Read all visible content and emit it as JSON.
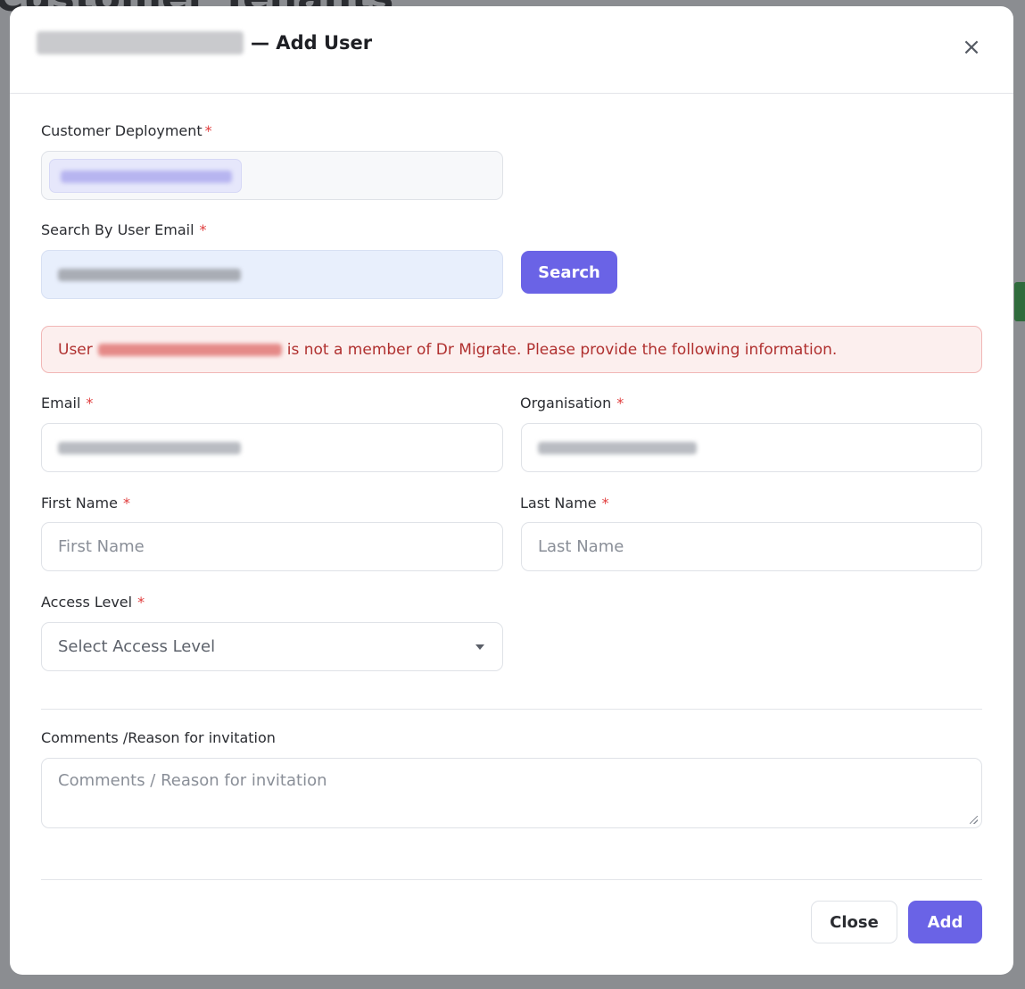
{
  "background": {
    "page_title": "Customer Tenants"
  },
  "modal": {
    "title_suffix": "— Add User",
    "close_icon": "×",
    "customer_deployment": {
      "label": "Customer Deployment"
    },
    "search_email": {
      "label": "Search By User Email",
      "button": "Search"
    },
    "alert": {
      "prefix": "User",
      "suffix": "is not a member of Dr Migrate. Please provide the following information."
    },
    "email": {
      "label": "Email"
    },
    "organisation": {
      "label": "Organisation"
    },
    "first_name": {
      "label": "First Name",
      "placeholder": "First Name"
    },
    "last_name": {
      "label": "Last Name",
      "placeholder": "Last Name"
    },
    "access_level": {
      "label": "Access Level",
      "placeholder": "Select Access Level"
    },
    "comments": {
      "label": "Comments /Reason for invitation",
      "placeholder": "Comments / Reason for invitation"
    },
    "footer": {
      "close": "Close",
      "add": "Add"
    },
    "required_mark": "*"
  },
  "colors": {
    "primary": "#6a63e6",
    "alert_text": "#b0302f",
    "alert_bg": "#fcefee",
    "required": "#e03b3b"
  }
}
